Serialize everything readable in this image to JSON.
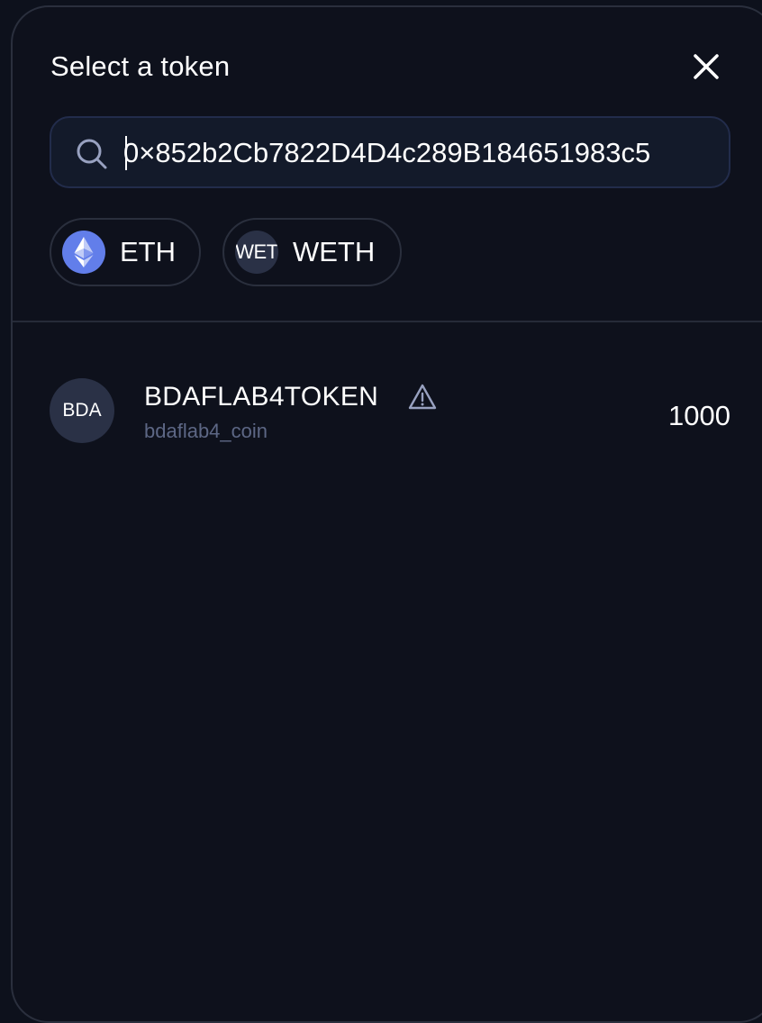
{
  "modal": {
    "title": "Select a token",
    "close_icon": "close-icon"
  },
  "search": {
    "value": "0×852b2Cb7822D4D4c289B184651983c5",
    "icon": "search-icon",
    "border_color": "#222c4b"
  },
  "common_bases": [
    {
      "symbol": "ETH",
      "logo": "eth-logo",
      "color": "#627eea"
    },
    {
      "symbol": "WETH",
      "logo_text": "WET"
    }
  ],
  "token_list": [
    {
      "logo_text": "BDA",
      "symbol": "BDAFLAB4TOKEN",
      "name": "bdaflab4_coin",
      "balance": "1000",
      "warning_icon": "warning-icon"
    }
  ],
  "colors": {
    "background": "#0d111c",
    "text_primary": "#ffffff",
    "text_secondary": "#5d6785",
    "eth_blue": "#627eea"
  }
}
